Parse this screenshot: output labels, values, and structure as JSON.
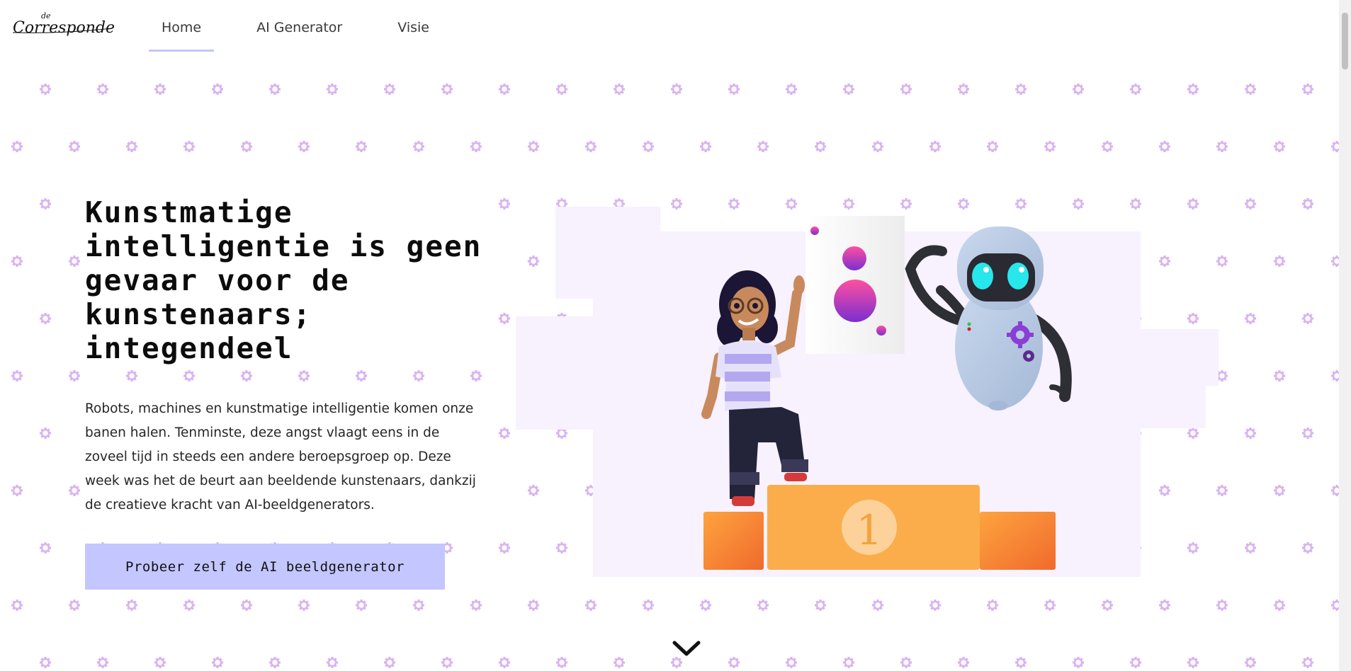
{
  "brand": {
    "logo_small": "de",
    "logo_name": "Correspondent"
  },
  "nav": {
    "items": [
      {
        "label": "Home",
        "active": true
      },
      {
        "label": "AI Generator",
        "active": false
      },
      {
        "label": "Visie",
        "active": false
      }
    ]
  },
  "hero": {
    "title": "Kunstmatige intelligentie is geen gevaar voor de kunstenaars; integendeel",
    "text": "Robots, machines en kunstmatige intelligentie komen onze banen halen. Tenminste, deze angst vlaagt eens in de zoveel tijd in steeds een andere beroepsgroep op. Deze week was het de beurt aan beeldende kunstenaars, dankzij de creatieve kracht van AI-beeldgenerators.",
    "cta_label": "Probeer zelf de AI beeldgenerator"
  },
  "illustration": {
    "podium_number": "1",
    "icons": [
      "girl-figure",
      "robot-figure",
      "artwork-canvas",
      "podium"
    ]
  },
  "icons": {
    "scroll_down": "chevron-down-icon",
    "pattern": "gear-icon"
  },
  "colors": {
    "accent": "#c4c6ff",
    "pattern": "#d9b3f0",
    "podium": "#fbad4b",
    "podium_side": "#f57b2f",
    "blob": "#f8f1fe"
  }
}
